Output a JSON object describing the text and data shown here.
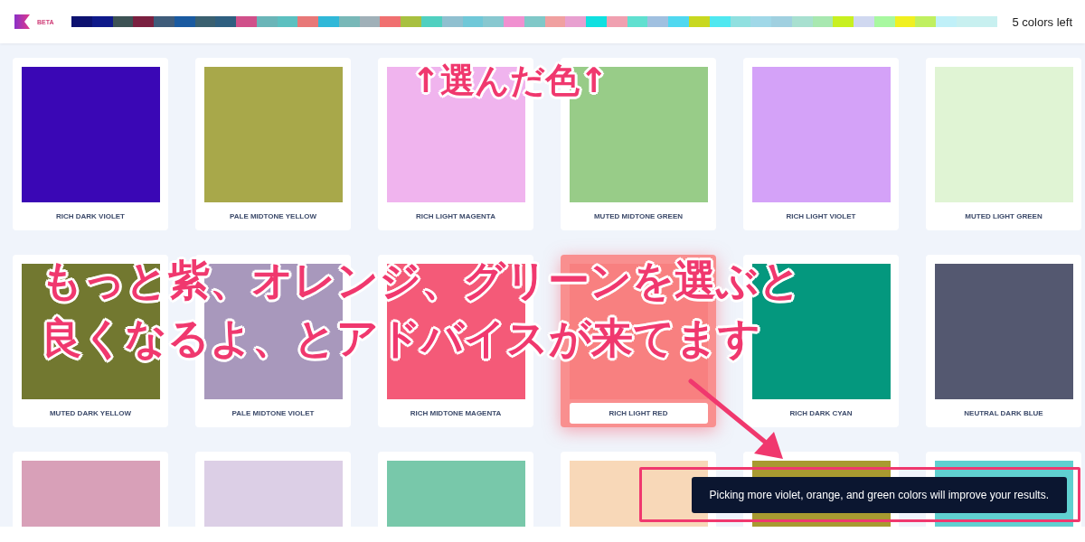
{
  "header": {
    "badge": "BETA",
    "remaining": "5 colors left",
    "palette": [
      {
        "color": "#0d1270"
      },
      {
        "color": "#0f1a8a"
      },
      {
        "color": "#3d5254"
      },
      {
        "color": "#7a2040"
      },
      {
        "color": "#3f5c7a"
      },
      {
        "color": "#1a5aa0"
      },
      {
        "color": "#3a6070"
      },
      {
        "color": "#2f5f80"
      },
      {
        "color": "#d0508a"
      },
      {
        "color": "#6ab5b8"
      },
      {
        "color": "#5cc0c0"
      },
      {
        "color": "#e87878"
      },
      {
        "color": "#30b8d8"
      },
      {
        "color": "#78b8b8"
      },
      {
        "color": "#a0b0b8"
      },
      {
        "color": "#f07070"
      },
      {
        "color": "#a8c040"
      },
      {
        "color": "#50d0c0"
      },
      {
        "color": "#90c0d0"
      },
      {
        "color": "#70c8d8"
      },
      {
        "color": "#88c8d0"
      },
      {
        "color": "#f090d0"
      },
      {
        "color": "#80c8c8"
      },
      {
        "color": "#f0a0a0"
      },
      {
        "color": "#e8a0d0"
      },
      {
        "color": "#10e0e0"
      },
      {
        "color": "#f0a0b0"
      },
      {
        "color": "#60e0d0"
      },
      {
        "color": "#a0c0e0"
      },
      {
        "color": "#50d8f0"
      },
      {
        "color": "#c8d820"
      },
      {
        "color": "#50e8f0"
      },
      {
        "color": "#90e0e0"
      },
      {
        "color": "#a0d8e8"
      },
      {
        "color": "#a0d0e0"
      },
      {
        "color": "#a8e0d0"
      },
      {
        "color": "#a8e8b0"
      },
      {
        "color": "#c8f020"
      },
      {
        "color": "#d0d8f0"
      },
      {
        "color": "#a8f8a0"
      },
      {
        "color": "#f0f020"
      },
      {
        "color": "#c0f060"
      },
      {
        "color": "#c0f0f8"
      },
      {
        "color": "#c8f0f0"
      },
      {
        "color": "#c8f0f0"
      }
    ]
  },
  "colors": [
    {
      "name": "RICH DARK VIOLET",
      "color": "#3a07b5",
      "selected": false
    },
    {
      "name": "PALE MIDTONE YELLOW",
      "color": "#a8a84a",
      "selected": false
    },
    {
      "name": "RICH LIGHT MAGENTA",
      "color": "#f0b4ee",
      "selected": false
    },
    {
      "name": "MUTED MIDTONE GREEN",
      "color": "#98cc88",
      "selected": false
    },
    {
      "name": "RICH LIGHT VIOLET",
      "color": "#d4a2f8",
      "selected": false
    },
    {
      "name": "MUTED LIGHT GREEN",
      "color": "#e0f4d4",
      "selected": false
    },
    {
      "name": "MUTED DARK YELLOW",
      "color": "#727830",
      "selected": false
    },
    {
      "name": "PALE MIDTONE VIOLET",
      "color": "#a898bc",
      "selected": false
    },
    {
      "name": "RICH MIDTONE MAGENTA",
      "color": "#f45a78",
      "selected": false
    },
    {
      "name": "RICH LIGHT RED",
      "color": "#f88080",
      "selected": true
    },
    {
      "name": "RICH DARK CYAN",
      "color": "#04987e",
      "selected": false
    },
    {
      "name": "NEUTRAL DARK BLUE",
      "color": "#545870",
      "selected": false
    },
    {
      "color": "#d8a0b8",
      "selected": false
    },
    {
      "color": "#dccfe6",
      "selected": false
    },
    {
      "color": "#78c8aa",
      "selected": false
    },
    {
      "color": "#f8d8b8",
      "selected": false
    },
    {
      "color": "#a89a30",
      "selected": false
    },
    {
      "color": "#60d0d0",
      "selected": false
    }
  ],
  "toast": "Picking more violet, orange, and green colors will improve your results.",
  "annotations": [
    {
      "kind": "caption",
      "text": "↑選んだ色↑"
    },
    {
      "kind": "callout",
      "text": "もっと紫、オレンジ、グリーンを選ぶと"
    },
    {
      "kind": "callout",
      "text": "良くなるよ、とアドバイスが来てます"
    }
  ]
}
